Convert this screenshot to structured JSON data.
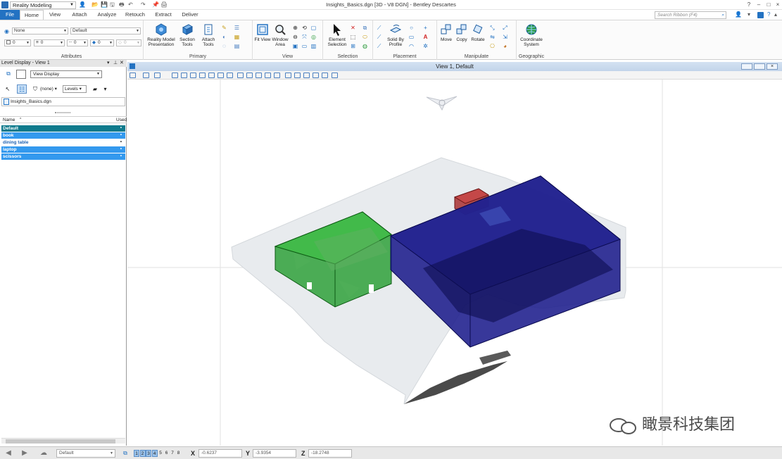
{
  "window": {
    "title": "Insights_Basics.dgn [3D - V8 DGN] - Bentley Descartes",
    "workflow": "Reality Modeling",
    "controls": [
      "?",
      "–",
      "□",
      "×"
    ]
  },
  "tabs": [
    "File",
    "Home",
    "View",
    "Attach",
    "Analyze",
    "Retouch",
    "Extract",
    "Deliver"
  ],
  "active_tab": "Home",
  "ribbon_search_placeholder": "Search Ribbon (F4)",
  "ribbon": {
    "attributes": {
      "label": "Attributes",
      "level": "None",
      "style": "Default",
      "color": "0",
      "weight": "0",
      "linestyle": "0",
      "priority": "0",
      "transparency": "0"
    },
    "primary": {
      "label": "Primary",
      "buttons": [
        "Reality Model Presentation",
        "Section Tools",
        "Attach Tools"
      ]
    },
    "view": {
      "label": "View",
      "buttons": [
        "Fit View",
        "Window Area"
      ]
    },
    "selection": {
      "label": "Selection",
      "buttons": [
        "Element Selection"
      ]
    },
    "placement": {
      "label": "Placement",
      "buttons": [
        "Solid By Profile"
      ]
    },
    "manipulate": {
      "label": "Manipulate",
      "buttons": [
        "Move",
        "Copy",
        "Rotate"
      ]
    },
    "geographic": {
      "label": "Geographic",
      "buttons": [
        "Coordinate System"
      ]
    }
  },
  "level_panel": {
    "title": "Level Display - View 1",
    "view_display": "View Display",
    "filter": "(none)",
    "levels_button": "Levels",
    "file": "Insights_Basics.dgn",
    "col_name": "Name",
    "col_used": "Used",
    "levels": [
      {
        "name": "Default",
        "used": "•",
        "style": "sel-dark"
      },
      {
        "name": "book",
        "used": "•",
        "style": "sel"
      },
      {
        "name": "dining table",
        "used": "•",
        "style": "plain"
      },
      {
        "name": "laptop",
        "used": "•",
        "style": "sel"
      },
      {
        "name": "scissors",
        "used": "•",
        "style": "sel"
      }
    ],
    "colors": {
      "sel_dark": "#0e7a8c",
      "sel": "#3399ee",
      "plain_text": "#1f63b4"
    }
  },
  "view": {
    "title": "View 1, Default",
    "scene_colors": {
      "book_box": "#1f9a2a",
      "laptop_box": "#1d1d8c",
      "scissors_box": "#a83030",
      "mesh": "#e8ebee"
    }
  },
  "status": {
    "active_level": "Default",
    "view_numbers": [
      "1",
      "2",
      "3",
      "4",
      "5",
      "6",
      "7",
      "8"
    ],
    "active_views": 4,
    "x_label": "X",
    "x_value": "-0.6237",
    "y_label": "Y",
    "y_value": "-3.9354",
    "z_label": "Z",
    "z_value": "-18.2748"
  },
  "watermark": "瞰景科技集团"
}
